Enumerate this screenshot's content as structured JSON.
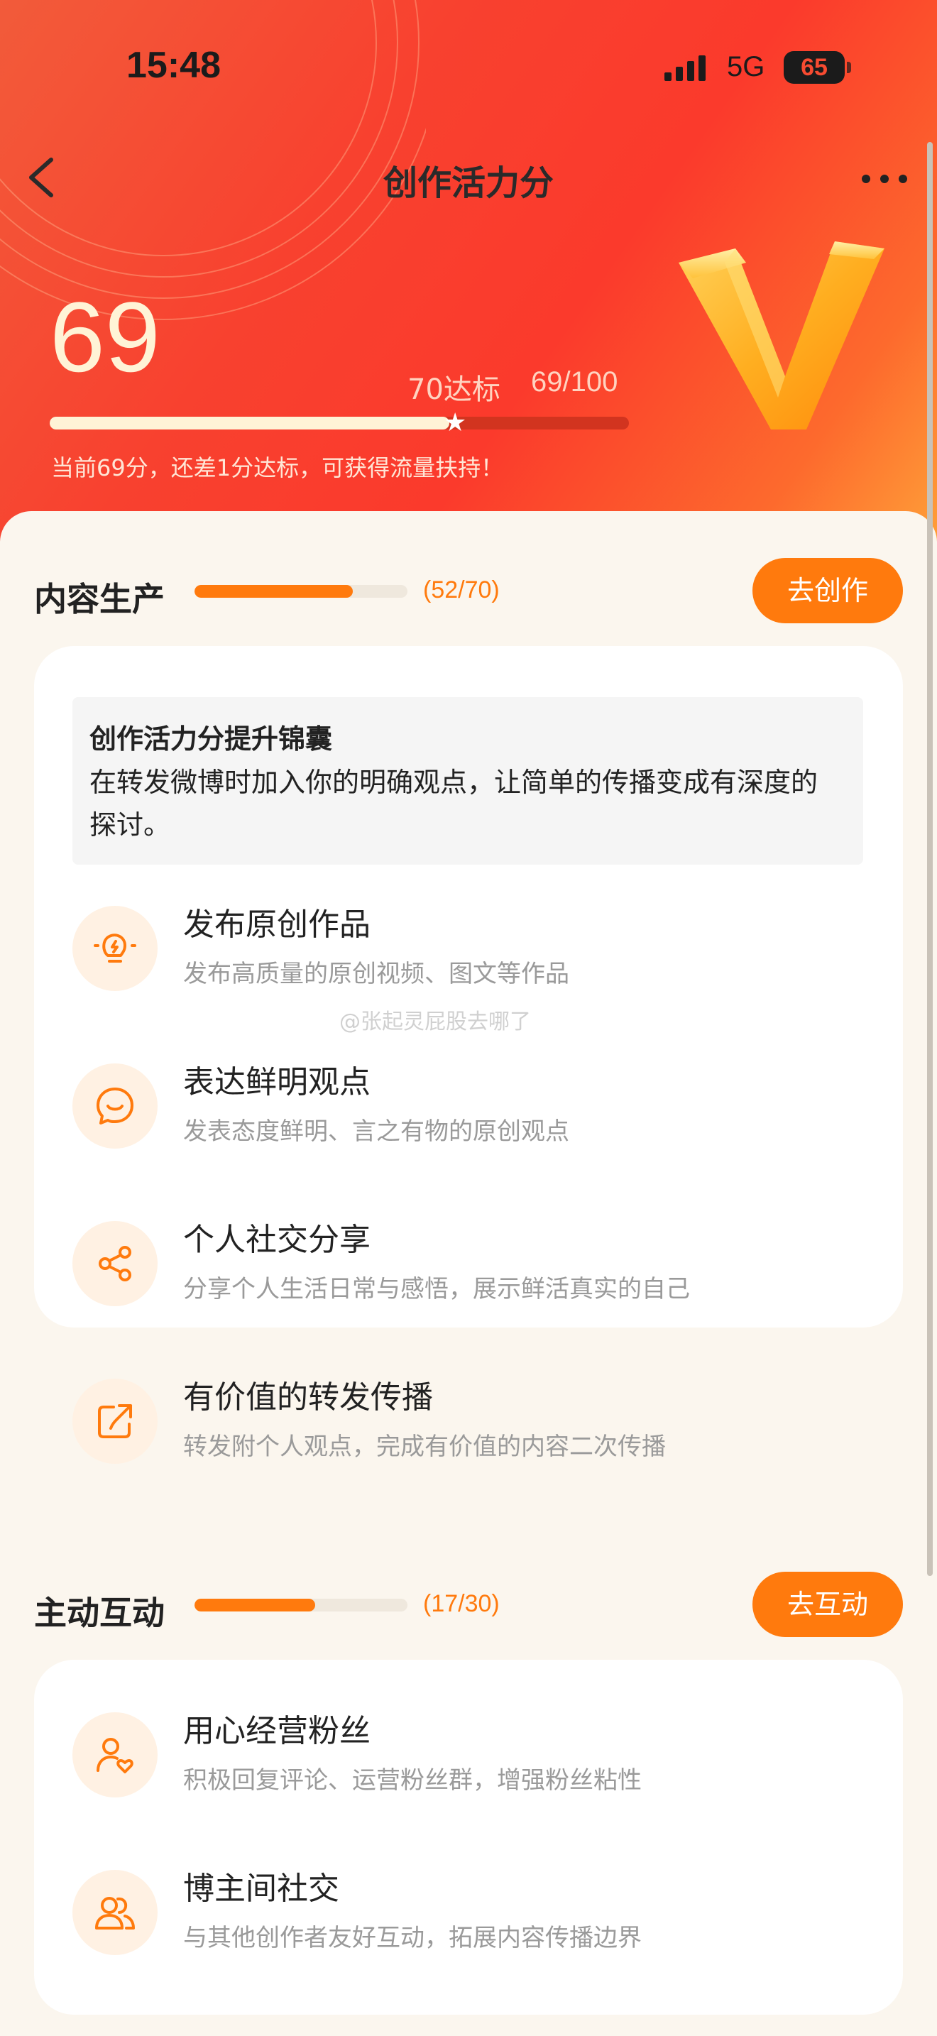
{
  "status_bar": {
    "time": "15:48",
    "network": "5G",
    "battery": "65"
  },
  "nav": {
    "title": "创作活力分"
  },
  "score": {
    "value": "69",
    "target_label": "70达标",
    "progress_label": "69/100",
    "progress_fraction": 0.69,
    "target_fraction": 0.7,
    "tip": "当前69分，还差1分达标，可获得流量扶持！"
  },
  "content_production": {
    "title": "内容生产",
    "count": "(52/70)",
    "progress_fraction": 0.743,
    "button": "去创作",
    "tip_title": "创作活力分提升锦囊",
    "tip_body": "在转发微博时加入你的明确观点，让简单的传播变成有深度的探讨。",
    "items": [
      {
        "title": "发布原创作品",
        "desc": "发布高质量的原创视频、图文等作品",
        "icon": "lightbulb-icon"
      },
      {
        "title": "表达鲜明观点",
        "desc": "发表态度鲜明、言之有物的原创观点",
        "icon": "chat-smile-icon"
      },
      {
        "title": "个人社交分享",
        "desc": "分享个人生活日常与感悟，展示鲜活真实的自己",
        "icon": "share-icon"
      },
      {
        "title": "有价值的转发传播",
        "desc": "转发附个人观点，完成有价值的内容二次传播",
        "icon": "forward-icon"
      }
    ]
  },
  "active_interaction": {
    "title": "主动互动",
    "count": "(17/30)",
    "progress_fraction": 0.567,
    "button": "去互动",
    "items": [
      {
        "title": "用心经营粉丝",
        "desc": "积极回复评论、运营粉丝群，增强粉丝粘性",
        "icon": "user-heart-icon"
      },
      {
        "title": "博主间社交",
        "desc": "与其他创作者友好互动，拓展内容传播边界",
        "icon": "users-icon"
      }
    ]
  },
  "watermark": "@张起灵屁股去哪了",
  "colors": {
    "accent": "#ff7a0d",
    "header_red": "#f8412f",
    "score_cream": "#fff3d6"
  }
}
